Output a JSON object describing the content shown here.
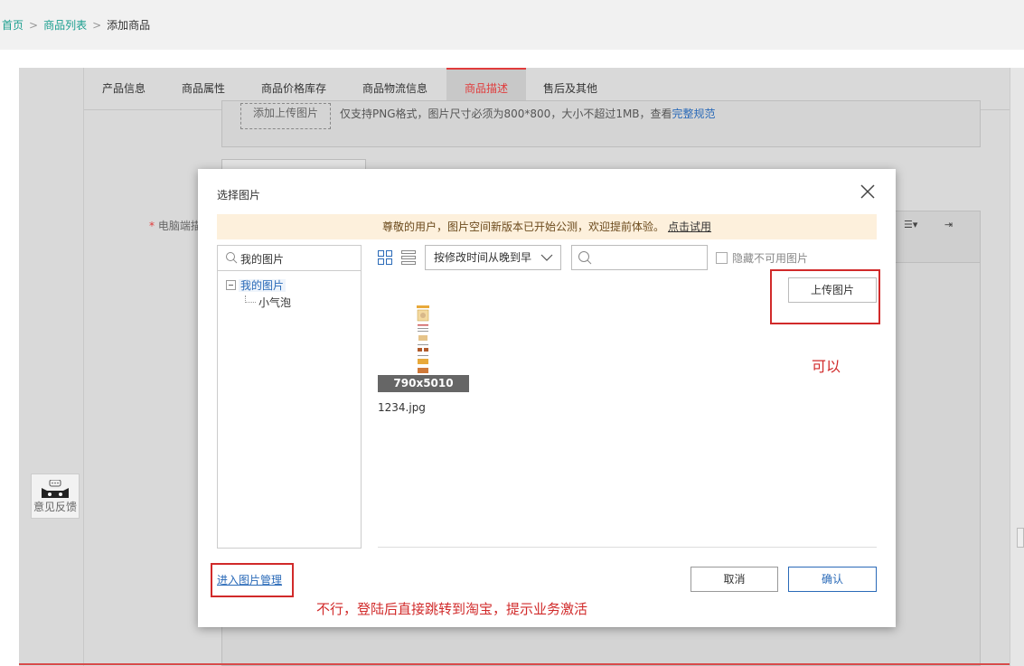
{
  "breadcrumb": {
    "home": "首页",
    "list": "商品列表",
    "current": "添加商品",
    "separator": ">"
  },
  "tabs": [
    {
      "label": "产品信息",
      "active": false
    },
    {
      "label": "商品属性",
      "active": false
    },
    {
      "label": "商品价格库存",
      "active": false
    },
    {
      "label": "商品物流信息",
      "active": false
    },
    {
      "label": "商品描述",
      "active": true
    },
    {
      "label": "售后及其他",
      "active": false
    }
  ],
  "form": {
    "upload_button": "添加上传图片",
    "upload_note": "仅支持PNG格式，图片尺寸必须为800*800，大小不超过1MB，查看",
    "upload_note_link": "完整规范",
    "pc_label": "电脑端描",
    "required_mark": "*"
  },
  "feedback": {
    "label": "意见反馈",
    "icon": "tmall-cat-icon"
  },
  "dialog": {
    "title": "选择图片",
    "notice": "尊敬的用户，图片空间新版本已开始公测，欢迎提前体验。",
    "notice_link": "点击试用",
    "tree_search_value": "我的图片",
    "tree_root": "我的图片",
    "tree_child": "小气泡",
    "sort_value": "按修改时间从晚到早",
    "search_placeholder": "",
    "hide_unavailable": "隐藏不可用图片",
    "upload_button": "上传图片",
    "thumb_dimensions": "790x5010",
    "thumb_filename": "1234.jpg",
    "manage_link": "进入图片管理",
    "cancel_button": "取消",
    "confirm_button": "确认"
  },
  "annotations": {
    "ok_note": "可以",
    "bad_note": "不行，登陆后直接跳转到淘宝，提示业务激活",
    "color": "#d12a2a"
  },
  "colors": {
    "accent_tab": "#e03c3c",
    "link": "#2a6ab8",
    "breadcrumb_link": "#1a9e8f",
    "notice_bg": "#fdf0dc"
  }
}
